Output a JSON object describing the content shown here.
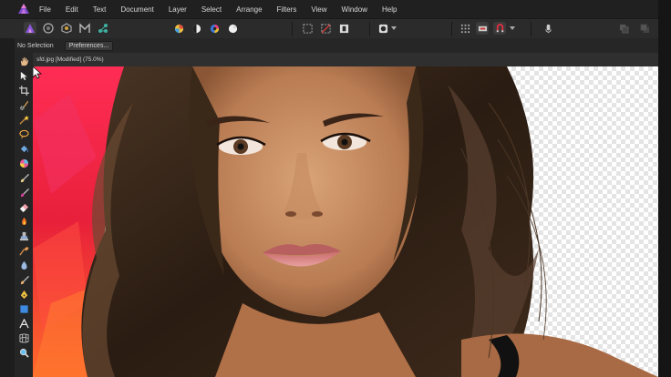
{
  "menu": [
    "File",
    "Edit",
    "Text",
    "Document",
    "Layer",
    "Select",
    "Arrange",
    "Filters",
    "View",
    "Window",
    "Help"
  ],
  "context": {
    "selection_label": "No Selection",
    "preferences_label": "Preferences..."
  },
  "document": {
    "tab_title": "sfd.jpg [Modified] (75.0%)"
  },
  "colors": {
    "accent": "#7b4bc8",
    "canvas_red": "#e8203a",
    "panel_bg": "#2b2b2b"
  }
}
